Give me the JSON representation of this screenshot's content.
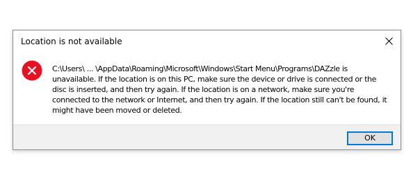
{
  "dialog": {
    "title": "Location is not available",
    "close_icon": "close-icon",
    "status_icon": "error-icon",
    "colors": {
      "error_red": "#e81123",
      "accent_border": "#0078d7",
      "footer_bg": "#f0f0f0"
    },
    "message_lines": [
      "C:\\Users\\ ... \\AppData\\Roaming\\Microsoft\\Windows\\Start Menu\\Programs\\DAZzle is",
      "unavailable. If the location is on this PC, make sure the device or drive is connected or the",
      "disc is inserted, and then try again. If the location is on a network, make sure you're",
      "connected to the network or Internet, and then try again. If the location still can't be found, it",
      "might have been moved or deleted."
    ],
    "ok_label": "OK"
  }
}
